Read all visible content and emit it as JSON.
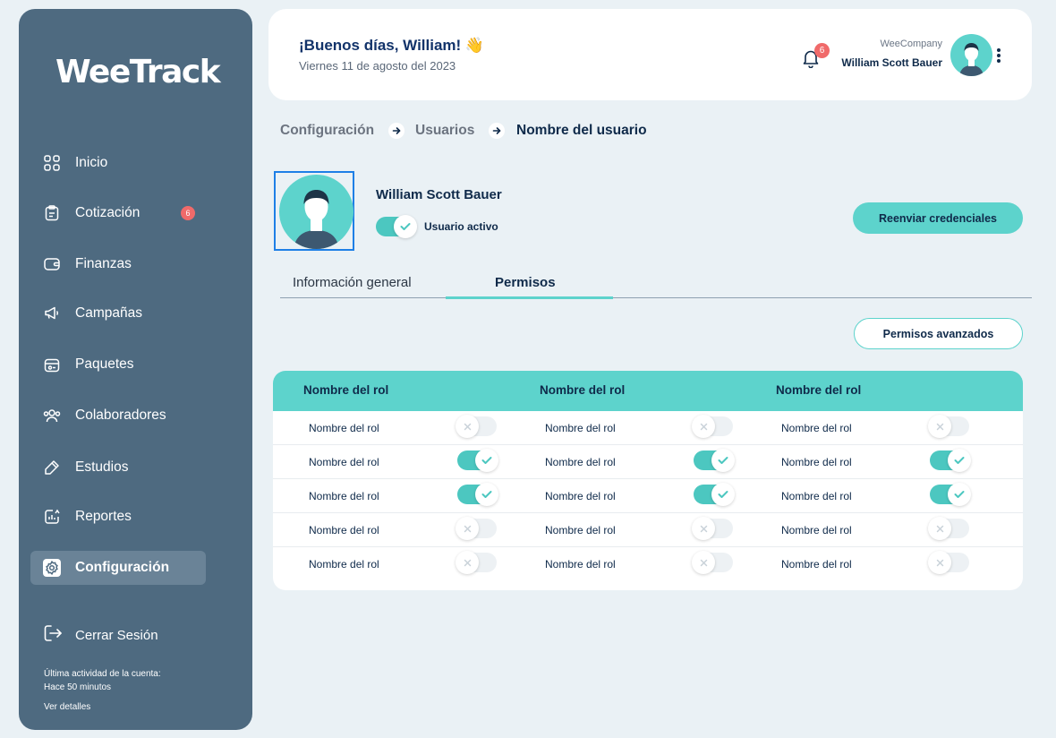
{
  "sidebar": {
    "logo": "WeeTrack",
    "items": [
      {
        "label": "Inicio",
        "icon": "grid-icon"
      },
      {
        "label": "Cotización",
        "icon": "clipboard-icon",
        "badge": "6"
      },
      {
        "label": "Finanzas",
        "icon": "wallet-icon"
      },
      {
        "label": "Campañas",
        "icon": "megaphone-icon"
      },
      {
        "label": "Paquetes",
        "icon": "package-icon"
      },
      {
        "label": "Colaboradores",
        "icon": "users-icon"
      },
      {
        "label": "Estudios",
        "icon": "pen-icon"
      },
      {
        "label": "Reportes",
        "icon": "report-icon"
      },
      {
        "label": "Configuración",
        "icon": "gear-icon",
        "active": true
      }
    ],
    "logout_label": "Cerrar Sesión",
    "activity_title": "Última actividad de la cuenta:",
    "activity_value": "Hace 50 minutos",
    "details_label": "Ver detalles"
  },
  "header": {
    "greeting": "¡Buenos días, William! 👋",
    "date": "Viernes 11 de agosto del 2023",
    "notifications_count": "6",
    "company": "WeeCompany",
    "user_name": "William Scott Bauer"
  },
  "breadcrumb": [
    "Configuración",
    "Usuarios",
    "Nombre del usuario"
  ],
  "profile": {
    "name": "William Scott Bauer",
    "status_label": "Usuario activo",
    "status_active": true,
    "resend_label": "Reenviar credenciales"
  },
  "tabs": [
    {
      "label": "Información general",
      "active": false
    },
    {
      "label": "Permisos",
      "active": true
    }
  ],
  "advanced_label": "Permisos avanzados",
  "table": {
    "headers": [
      "Nombre del rol",
      "Nombre del rol",
      "Nombre del rol"
    ],
    "rows": [
      {
        "labels": [
          "Nombre del rol",
          "Nombre del rol",
          "Nombre del rol"
        ],
        "states": [
          false,
          false,
          false
        ]
      },
      {
        "labels": [
          "Nombre del rol",
          "Nombre del rol",
          "Nombre del rol"
        ],
        "states": [
          true,
          true,
          true
        ]
      },
      {
        "labels": [
          "Nombre del rol",
          "Nombre del rol",
          "Nombre del rol"
        ],
        "states": [
          true,
          true,
          true
        ]
      },
      {
        "labels": [
          "Nombre del rol",
          "Nombre del rol",
          "Nombre del rol"
        ],
        "states": [
          false,
          false,
          false
        ]
      },
      {
        "labels": [
          "Nombre del rol",
          "Nombre del rol",
          "Nombre del rol"
        ],
        "states": [
          false,
          false,
          false
        ]
      }
    ]
  },
  "colors": {
    "sidebar": "#4E6A80",
    "accent": "#5DD3CC",
    "toggle_on": "#4CC7C0",
    "badge": "#F06A6A",
    "text_dark": "#0F2A4A"
  }
}
